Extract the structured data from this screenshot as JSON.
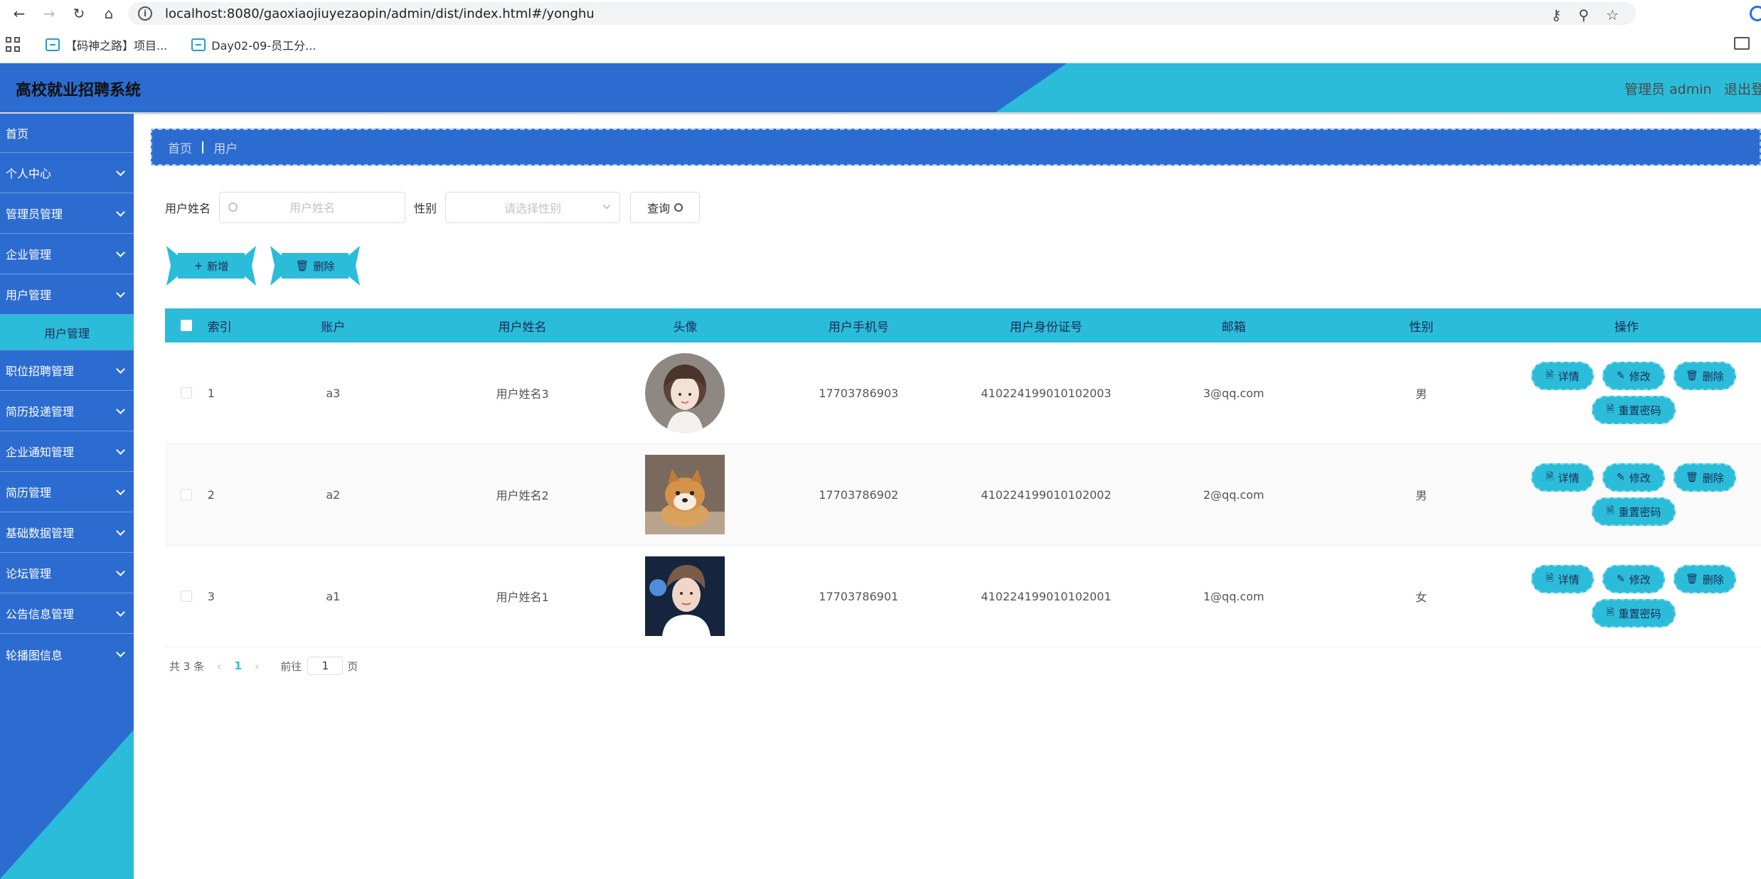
{
  "browser": {
    "url": "localhost:8080/gaoxiaojiuyezaopin/admin/dist/index.html#/yonghu",
    "bookmarks": [
      "【码神之路】项目...",
      "Day02-09-员工分..."
    ]
  },
  "header": {
    "title": "高校就业招聘系统",
    "user": "管理员 admin",
    "logout": "退出登"
  },
  "sidebar": {
    "home": "首页",
    "items": [
      "个人中心",
      "管理员管理",
      "企业管理",
      "用户管理"
    ],
    "active_sub": "用户管理",
    "items_after": [
      "职位招聘管理",
      "简历投递管理",
      "企业通知管理",
      "简历管理",
      "基础数据管理",
      "论坛管理",
      "公告信息管理",
      "轮播图信息"
    ]
  },
  "breadcrumb": {
    "home": "首页",
    "separator": "|",
    "current": "用户"
  },
  "search": {
    "name_label": "用户姓名",
    "name_placeholder": "用户姓名",
    "gender_label": "性别",
    "gender_placeholder": "请选择性别",
    "query_label": "查询"
  },
  "actions": {
    "add_label": "新增",
    "delete_label": "删除"
  },
  "table": {
    "columns": [
      "索引",
      "账户",
      "用户姓名",
      "头像",
      "用户手机号",
      "用户身份证号",
      "邮箱",
      "性别",
      "操作"
    ],
    "rows": [
      {
        "index": "1",
        "account": "a3",
        "name": "用户姓名3",
        "avatar": "girl-illustration",
        "phone": "17703786903",
        "id_card": "410224199010102003",
        "email": "3@qq.com",
        "gender": "男"
      },
      {
        "index": "2",
        "account": "a2",
        "name": "用户姓名2",
        "avatar": "shiba-dog-photo",
        "phone": "17703786902",
        "id_card": "410224199010102002",
        "email": "2@qq.com",
        "gender": "男"
      },
      {
        "index": "3",
        "account": "a1",
        "name": "用户姓名1",
        "avatar": "boy-portrait-photo",
        "phone": "17703786901",
        "id_card": "410224199010102001",
        "email": "1@qq.com",
        "gender": "女"
      }
    ],
    "op_labels": {
      "detail": "详情",
      "edit": "修改",
      "delete": "删除",
      "reset_password": "重置密码"
    }
  },
  "pagination": {
    "total": "共 3 条",
    "current_page": "1",
    "goto_label": "前往",
    "goto_value": "1",
    "page_unit": "页"
  },
  "colors": {
    "primary_blue": "#2c6bcf",
    "accent_cyan": "#2bbcd9"
  }
}
